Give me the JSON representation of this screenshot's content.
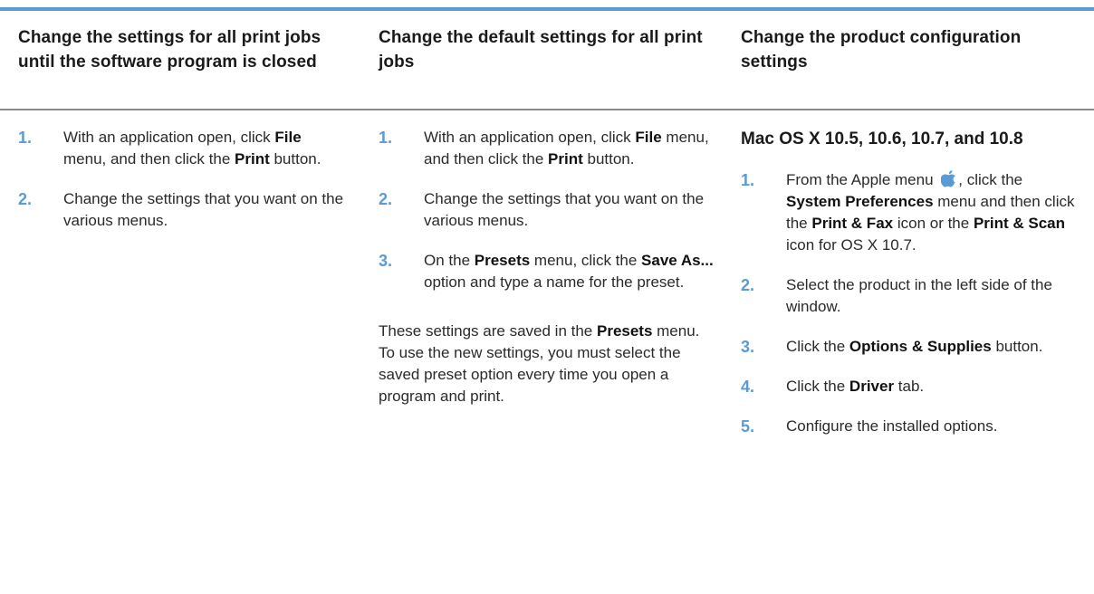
{
  "colors": {
    "accent": "#5a9bd5",
    "rule": "#8a8a8a"
  },
  "icons": {
    "apple_menu": "apple-logo-icon"
  },
  "headers": [
    "Change the settings for all print jobs until the software program is closed",
    "Change the default settings for all print jobs",
    "Change the product configuration settings"
  ],
  "col1": {
    "steps": [
      {
        "num": "1.",
        "t1": "With an application open, click ",
        "b1": "File",
        "t2": " menu, and then click the ",
        "b2": "Print",
        "t3": " button."
      },
      {
        "num": "2.",
        "t1": "Change the settings that you want on the various menus."
      }
    ]
  },
  "col2": {
    "steps": [
      {
        "num": "1.",
        "t1": "With an application open, click ",
        "b1": "File",
        "t2": " menu, and then click the ",
        "b2": "Print",
        "t3": " button."
      },
      {
        "num": "2.",
        "t1": "Change the settings that you want on the various menus."
      },
      {
        "num": "3.",
        "t1": "On the ",
        "b1": "Presets",
        "t2": " menu, click the ",
        "b2": "Save As...",
        "t3": " option and type a name for the preset."
      }
    ],
    "note": {
      "t1": "These settings are saved in the ",
      "b1": "Presets",
      "t2": " menu. To use the new settings, you must select the saved preset option every time you open a program and print."
    }
  },
  "col3": {
    "subhead": "Mac OS X 10.5, 10.6, 10.7, and 10.8",
    "steps": [
      {
        "num": "1.",
        "t1": "From the Apple menu ",
        "t2": ", click the ",
        "b1": "System Preferences",
        "t3": " menu and then click the ",
        "b2": "Print & Fax",
        "t4": " icon or the ",
        "b3": "Print & Scan",
        "t5": " icon for OS X 10.7."
      },
      {
        "num": "2.",
        "t1": "Select the product in the left side of the window."
      },
      {
        "num": "3.",
        "t1": "Click the ",
        "b1": "Options & Supplies",
        "t2": " button."
      },
      {
        "num": "4.",
        "t1": "Click the ",
        "b1": "Driver",
        "t2": " tab."
      },
      {
        "num": "5.",
        "t1": "Configure the installed options."
      }
    ]
  }
}
